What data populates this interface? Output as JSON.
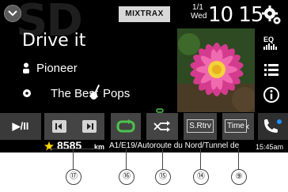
{
  "header": {
    "watermark": "SD",
    "mode_badge": "MIXTRAX",
    "date_day": "1/1",
    "date_weekday": "Wed",
    "clock": "10 15"
  },
  "track": {
    "title": "Drive it",
    "artist": "Pioneer",
    "album": "The Best",
    "genre": "Pops"
  },
  "side": {
    "eq_label": "EQ"
  },
  "controls": {
    "play_pause": "▶/II",
    "sound_retriever": "S.Rtrv",
    "time": "Time"
  },
  "navigation": {
    "distance": "8585",
    "unit": "km",
    "road": "A1/E19/Autoroute du Nord/Tunnel de",
    "time": "15:45am"
  },
  "callouts": [
    "⑰",
    "⑯",
    "⑮",
    "⑭",
    "⑨"
  ],
  "colors": {
    "screen_bg": "#000000",
    "button_bg": "#444444",
    "repeat_accent": "#4cc34c",
    "phone_accent": "#1e90ff",
    "star": "#ffd700"
  }
}
